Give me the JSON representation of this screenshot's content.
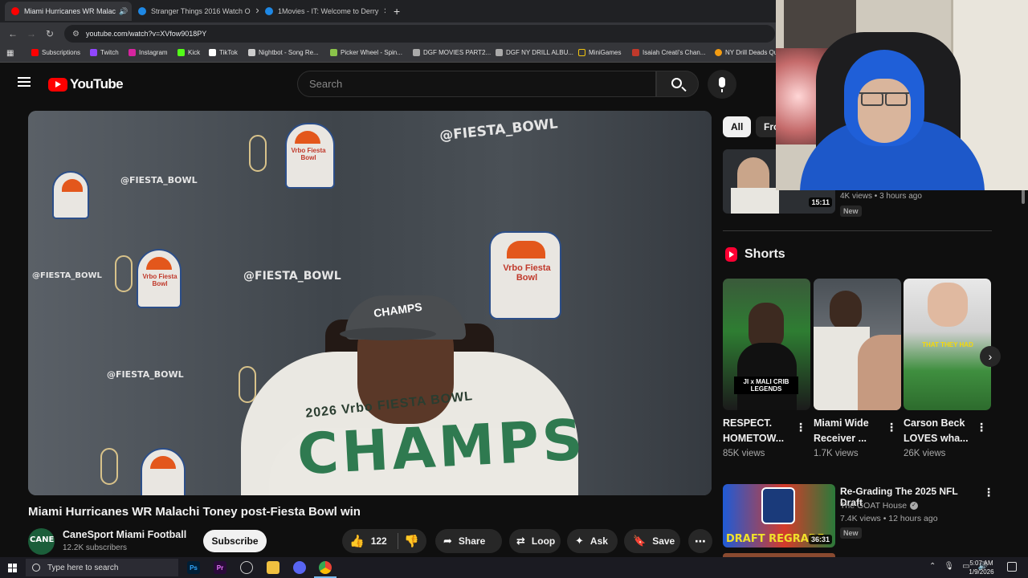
{
  "browser": {
    "tabs": [
      {
        "title": "Miami Hurricanes WR Malac",
        "active": true,
        "favicon_color": "#ff0000"
      },
      {
        "title": "Stranger Things 2016 Watch O",
        "active": false,
        "favicon_color": "#1e88e5"
      },
      {
        "title": "1Movies - IT: Welcome to Derry",
        "active": false,
        "favicon_color": "#1e88e5"
      }
    ],
    "new_tab": "+",
    "url": "youtube.com/watch?v=XVfow9018PY",
    "bookmarks": [
      {
        "label": "Subscriptions",
        "color": "#ff0000"
      },
      {
        "label": "Twitch",
        "color": "#9146ff"
      },
      {
        "label": "Instagram",
        "color": "#d6249f"
      },
      {
        "label": "Kick",
        "color": "#53fc18"
      },
      {
        "label": "TikTok",
        "color": "#ffffff"
      },
      {
        "label": "Nightbot - Song Re...",
        "color": "#cccccc"
      },
      {
        "label": "Picker Wheel - Spin...",
        "color": "#8bc34a"
      },
      {
        "label": "DGF MOVIES PART2...",
        "color": "#aaaaaa"
      },
      {
        "label": "DGF NY DRILL ALBU...",
        "color": "#aaaaaa"
      },
      {
        "label": "MiniGames",
        "color": "#f1c40f"
      },
      {
        "label": "Isaiah Creati's Chan...",
        "color": "#c0392b"
      },
      {
        "label": "NY Drill Deads Qu",
        "color": "#f39c12"
      }
    ]
  },
  "youtube": {
    "logo_text": "YouTube",
    "search_placeholder": "Search",
    "video": {
      "title": "Miami Hurricanes WR Malachi Toney post-Fiesta Bowl win",
      "wall_handle": "@FIESTA_BOWL",
      "badge_text": "Vrbo Fiesta Bowl",
      "cap_text": "CHAMPS",
      "shirt_line1": "2026 Vrbo FIESTA BOWL",
      "shirt_line2": "CHAMPS"
    },
    "channel": {
      "name": "CaneSport Miami Football",
      "subscribers": "12.2K subscribers",
      "avatar_text": "CANE"
    },
    "actions": {
      "subscribe": "Subscribe",
      "likes": "122",
      "share": "Share",
      "loop": "Loop",
      "ask": "Ask",
      "save": "Save"
    },
    "sidebar": {
      "chips": [
        "All",
        "Fro"
      ],
      "top_item": {
        "duration": "15:11",
        "meta": "4K views • 3 hours ago",
        "badge": "New"
      },
      "shorts_heading": "Shorts",
      "shorts": [
        {
          "title": "RESPECT. HOMETOW...",
          "views": "85K views",
          "overlay": "JI x MALI CRIB LEGENDS"
        },
        {
          "title": "Miami Wide Receiver ...",
          "views": "1.7K views",
          "overlay": ""
        },
        {
          "title": "Carson Beck LOVES wha...",
          "views": "26K views",
          "overlay": "THAT THEY HAD"
        }
      ],
      "video2": {
        "title": "Re-Grading The 2025 NFL Draft",
        "channel": "The GOAT House",
        "meta": "7.4K views • 12 hours ago",
        "badge": "New",
        "duration": "36:31",
        "thumb_text": "DRAFT REGRADE"
      }
    }
  },
  "taskbar": {
    "search_text": "Type here to search",
    "time": "5:07 AM",
    "date": "1/9/2026"
  }
}
